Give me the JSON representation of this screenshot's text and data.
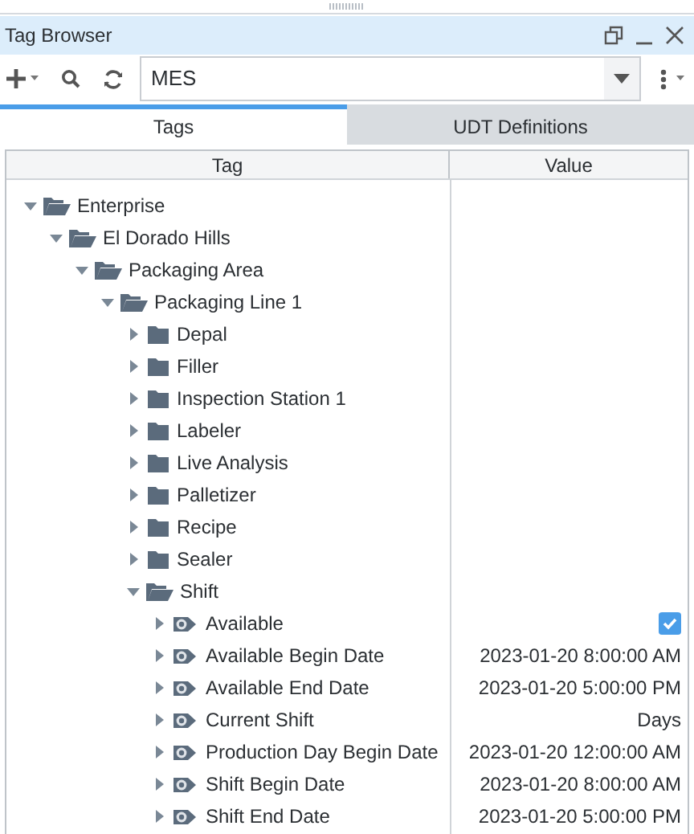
{
  "window": {
    "title": "Tag Browser"
  },
  "toolbar": {
    "provider": "MES"
  },
  "tabs": [
    {
      "label": "Tags",
      "selected": true
    },
    {
      "label": "UDT Definitions",
      "selected": false
    }
  ],
  "table": {
    "columns": [
      "Tag",
      "Value"
    ],
    "tree": [
      {
        "label": "Enterprise",
        "kind": "folder",
        "expanded": true,
        "children": [
          {
            "label": "El Dorado Hills",
            "kind": "folder",
            "expanded": true,
            "children": [
              {
                "label": "Packaging Area",
                "kind": "folder",
                "expanded": true,
                "children": [
                  {
                    "label": "Packaging Line 1",
                    "kind": "folder",
                    "expanded": true,
                    "children": [
                      {
                        "label": "Depal",
                        "kind": "folder",
                        "expanded": false
                      },
                      {
                        "label": "Filler",
                        "kind": "folder",
                        "expanded": false
                      },
                      {
                        "label": "Inspection Station 1",
                        "kind": "folder",
                        "expanded": false
                      },
                      {
                        "label": "Labeler",
                        "kind": "folder",
                        "expanded": false
                      },
                      {
                        "label": "Live Analysis",
                        "kind": "folder",
                        "expanded": false
                      },
                      {
                        "label": "Palletizer",
                        "kind": "folder",
                        "expanded": false
                      },
                      {
                        "label": "Recipe",
                        "kind": "folder",
                        "expanded": false
                      },
                      {
                        "label": "Sealer",
                        "kind": "folder",
                        "expanded": false
                      },
                      {
                        "label": "Shift",
                        "kind": "folder",
                        "expanded": true,
                        "children": [
                          {
                            "label": "Available",
                            "kind": "udt",
                            "expanded": false,
                            "value": {
                              "kind": "boolean",
                              "checked": true
                            }
                          },
                          {
                            "label": "Available Begin Date",
                            "kind": "udt",
                            "expanded": false,
                            "value": {
                              "kind": "text",
                              "text": "2023-01-20 8:00:00 AM"
                            }
                          },
                          {
                            "label": "Available End Date",
                            "kind": "udt",
                            "expanded": false,
                            "value": {
                              "kind": "text",
                              "text": "2023-01-20 5:00:00 PM"
                            }
                          },
                          {
                            "label": "Current Shift",
                            "kind": "udt",
                            "expanded": false,
                            "value": {
                              "kind": "text",
                              "text": "Days"
                            }
                          },
                          {
                            "label": "Production Day Begin Date",
                            "kind": "udt",
                            "expanded": false,
                            "value": {
                              "kind": "text",
                              "text": "2023-01-20 12:00:00 AM"
                            }
                          },
                          {
                            "label": "Shift Begin Date",
                            "kind": "udt",
                            "expanded": false,
                            "value": {
                              "kind": "text",
                              "text": "2023-01-20 8:00:00 AM"
                            }
                          },
                          {
                            "label": "Shift End Date",
                            "kind": "udt",
                            "expanded": false,
                            "value": {
                              "kind": "text",
                              "text": "2023-01-20 5:00:00 PM"
                            }
                          }
                        ]
                      }
                    ]
                  }
                ]
              }
            ]
          }
        ]
      }
    ]
  }
}
